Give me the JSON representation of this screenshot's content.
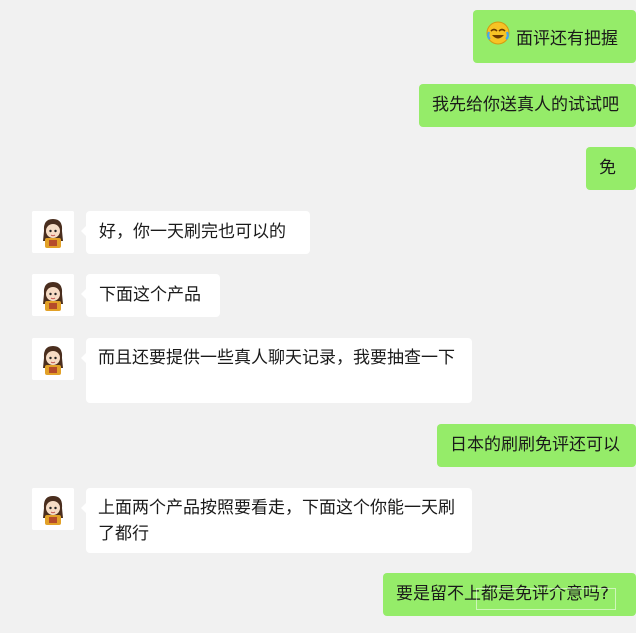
{
  "messages": [
    {
      "side": "out",
      "text": "面评还有把握",
      "emoji": "laughing-crying-emoji"
    },
    {
      "side": "out",
      "text": "我先给你送真人的试试吧"
    },
    {
      "side": "out",
      "text": "免"
    },
    {
      "side": "in",
      "text": "好，你一天刷完也可以的"
    },
    {
      "side": "in",
      "text": "下面这个产品"
    },
    {
      "side": "in",
      "text": "而且还要提供一些真人聊天记录，我要抽查一下"
    },
    {
      "side": "out",
      "text": "日本的刷刷免评还可以"
    },
    {
      "side": "in",
      "text": "上面两个产品按照要看走，下面这个你能一天刷了都行"
    },
    {
      "side": "out",
      "text": "要是留不上都是免评介意吗?"
    }
  ],
  "colors": {
    "background": "#f1f1f1",
    "outgoing_bubble": "#95ec69",
    "incoming_bubble": "#ffffff"
  }
}
